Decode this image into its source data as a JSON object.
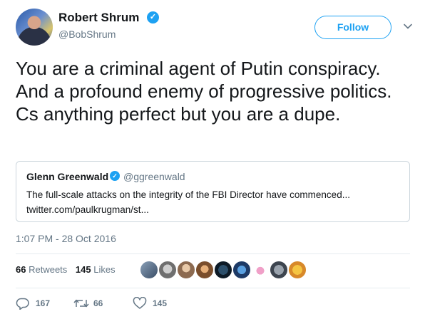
{
  "tweet": {
    "author": {
      "name": "Robert Shrum",
      "handle": "@BobShrum"
    },
    "follow_label": "Follow",
    "text": "You are a criminal agent of Putin conspiracy. And a profound enemy of progressive politics. Cs anything perfect but you are a dupe.",
    "quote": {
      "name": "Glenn Greenwald",
      "handle": "@ggreenwald",
      "text": "The full-scale attacks on the integrity of the FBI Director have commenced...",
      "link": "twitter.com/paulkrugman/st..."
    },
    "timestamp": "1:07 PM - 28 Oct 2016",
    "stats": {
      "retweets_count": "66",
      "retweets_label": "Retweets",
      "likes_count": "145",
      "likes_label": "Likes"
    },
    "actions": {
      "replies": "167",
      "retweets": "66",
      "likes": "145"
    }
  },
  "colors": {
    "accent": "#1da1f2",
    "secondary_text": "#657786",
    "border": "#ccd6dd"
  },
  "icons": [
    "verified-badge-icon",
    "chevron-down-icon",
    "reply-icon",
    "retweet-icon",
    "like-icon"
  ]
}
